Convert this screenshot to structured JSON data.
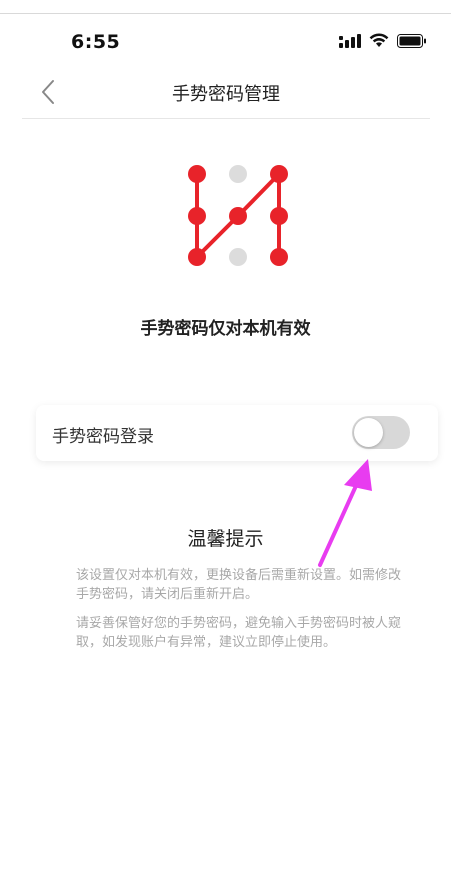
{
  "status_bar": {
    "time": "6:55"
  },
  "nav": {
    "title": "手势密码管理"
  },
  "subtitle": "手势密码仅对本机有效",
  "setting": {
    "label": "手势密码登录",
    "enabled": false
  },
  "tips": {
    "title": "温馨提示",
    "lines": [
      "该设置仅对本机有效，更换设备后需重新设置。如需修改手势密码，请关闭后重新开启。",
      "请妥善保管好您的手势密码，避免输入手势密码时被人窥取，如发现账户有异常，建议立即停止使用。"
    ]
  },
  "colors": {
    "pattern_active": "#e8232a",
    "pattern_inactive": "#dcdcdc",
    "annotation_arrow": "#e83cf0"
  }
}
